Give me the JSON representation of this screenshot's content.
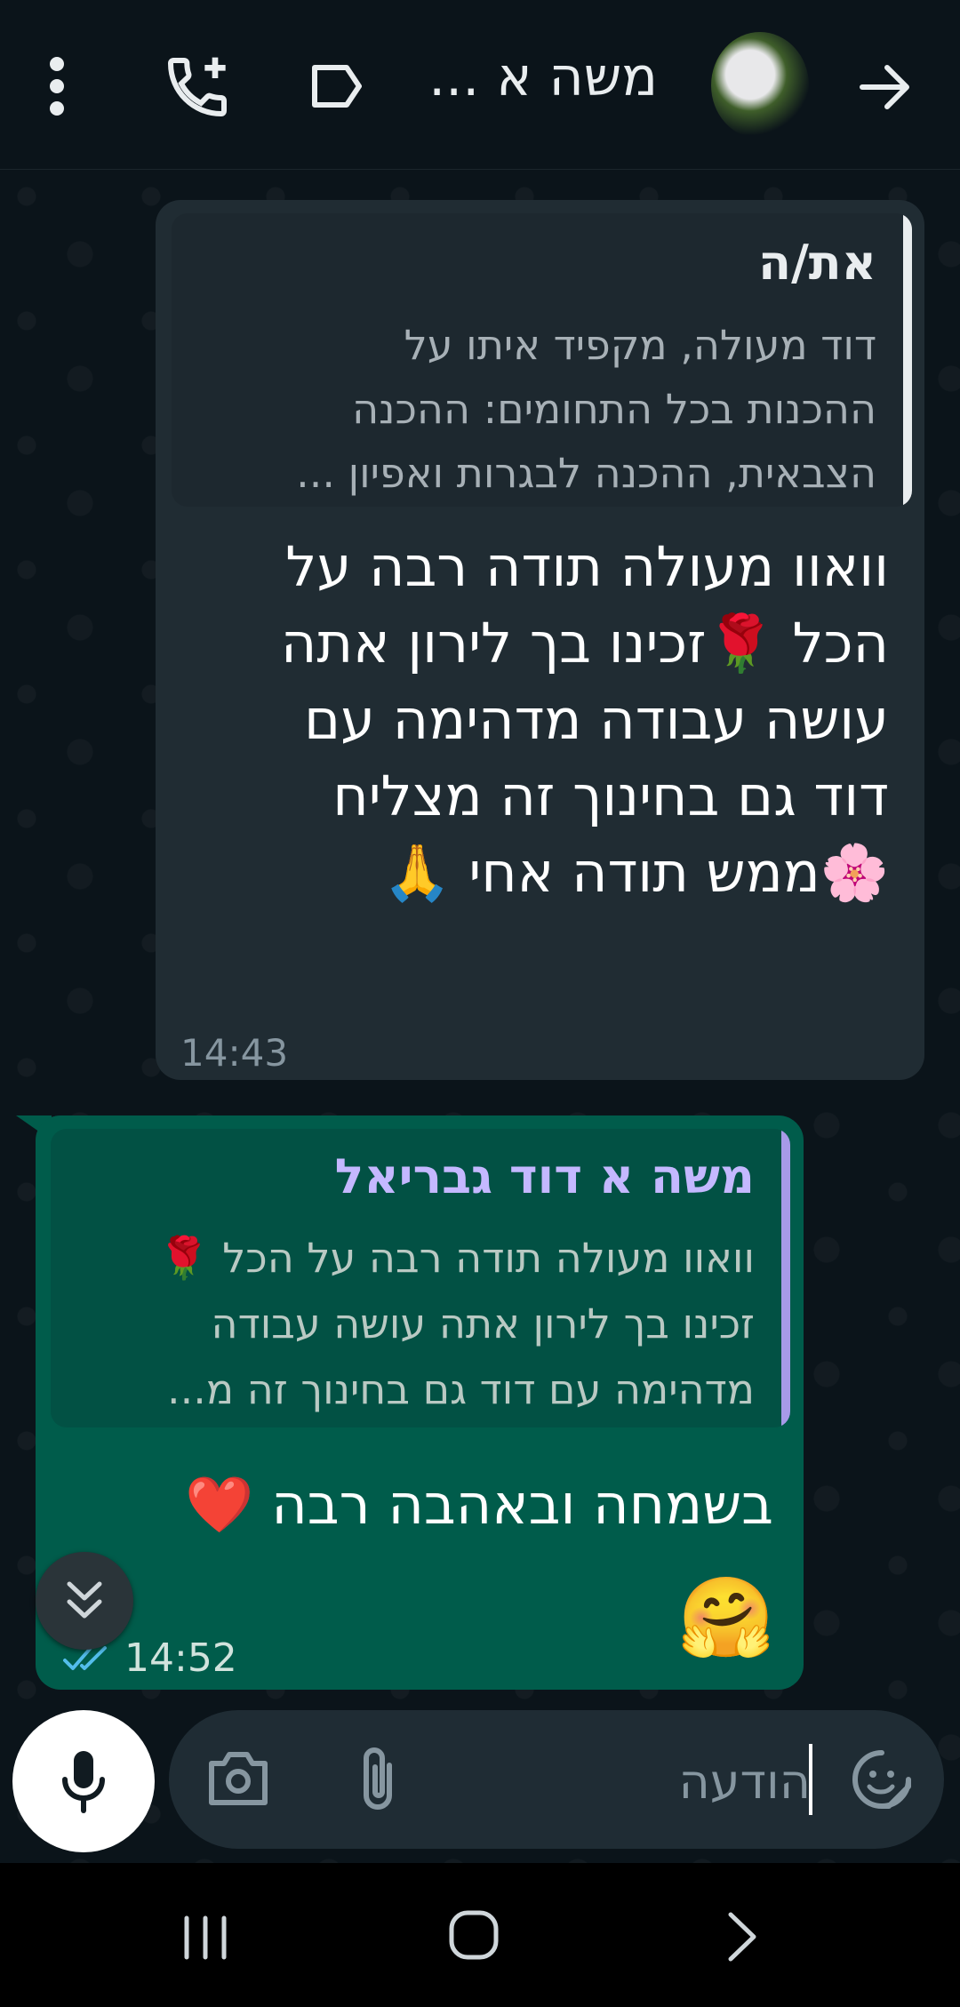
{
  "header": {
    "contact_name": "משה א ...",
    "back_icon": "arrow-right-icon",
    "icons": [
      "more-vert-icon",
      "add-call-icon",
      "label-icon"
    ]
  },
  "incoming": {
    "quote": {
      "name": "את/ה",
      "lines": [
        "דוד מעולה, מקפיד איתו על",
        "ההכנות בכל התחומים: ההכנה",
        "הצבאית, ההכנה לבגרות ואפיון ..."
      ]
    },
    "lines": [
      "וואוו מעולה תודה רבה על",
      "הכל 🌹זכינו בך לירון אתה",
      "עושה עבודה מדהימה עם",
      "דוד גם בחינוך זה מצליח",
      "🌸ממש תודה אחי 🙏"
    ],
    "time": "14:43"
  },
  "outgoing": {
    "quote": {
      "name": "משה א דוד גבריאל",
      "lines": [
        "וואוו מעולה תודה רבה על הכל 🌹",
        "זכינו בך לירון אתה עושה עבודה",
        "מדהימה עם דוד גם בחינוך זה מ..."
      ]
    },
    "text": "בשמחה ובאהבה רבה ❤️",
    "emoji": "🤗",
    "time": "14:52"
  },
  "composer": {
    "placeholder": "הודעה"
  },
  "colors": {
    "bg": "#0b141a",
    "incoming": "#202c33",
    "outgoing": "#005c4b",
    "quote_accent_out": "#a79ae8",
    "read_ticks": "#53bdeb"
  }
}
